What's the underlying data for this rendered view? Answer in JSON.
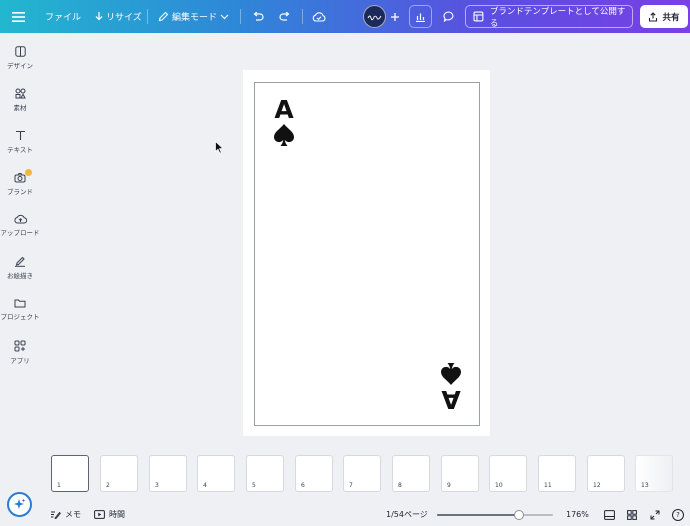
{
  "topbar": {
    "file_label": "ファイル",
    "resize_label": "リサイズ",
    "edit_mode_label": "編集モード",
    "publish_label": "ブランドテンプレートとして公開する",
    "share_label": "共有"
  },
  "sidebar": {
    "items": [
      {
        "label": "デザイン",
        "icon": "layout-icon"
      },
      {
        "label": "素材",
        "icon": "elements-icon"
      },
      {
        "label": "テキスト",
        "icon": "text-icon"
      },
      {
        "label": "ブランド",
        "icon": "brand-icon"
      },
      {
        "label": "アップロード",
        "icon": "upload-cloud-icon"
      },
      {
        "label": "お絵描き",
        "icon": "draw-icon"
      },
      {
        "label": "プロジェクト",
        "icon": "folder-icon"
      },
      {
        "label": "アプリ",
        "icon": "apps-icon"
      }
    ]
  },
  "card": {
    "rank": "A",
    "suit": "spade-icon"
  },
  "thumbnails": [
    "1",
    "2",
    "3",
    "4",
    "5",
    "6",
    "7",
    "8",
    "9",
    "10",
    "11",
    "12",
    "13"
  ],
  "bottombar": {
    "notes_label": "メモ",
    "timer_label": "時間",
    "page_indicator": "1/54ページ",
    "zoom_value": 0.71,
    "zoom_label": "176%",
    "help_label": "?"
  },
  "colors": {
    "accent_blue": "#2a7bd6",
    "brand_badge": "#f4b63d",
    "avatar_bg": "#1c2a5a"
  }
}
